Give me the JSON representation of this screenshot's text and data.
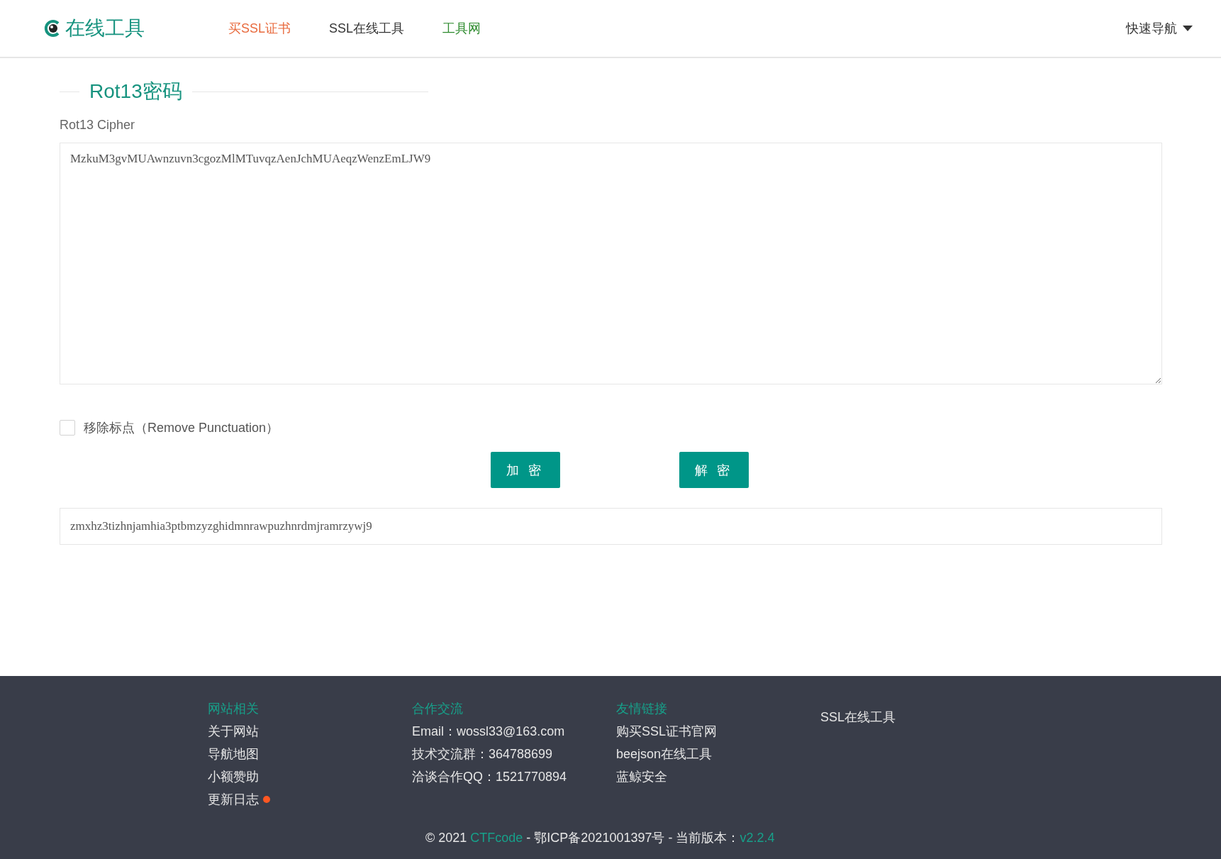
{
  "header": {
    "logo": "在线工具",
    "nav": [
      {
        "label": "买SSL证书",
        "color": "#e8693c"
      },
      {
        "label": "SSL在线工具",
        "color": "#333333"
      },
      {
        "label": "工具网",
        "color": "#2e8b2e"
      }
    ],
    "quick_nav": "快速导航"
  },
  "tool": {
    "title": "Rot13密码",
    "subtitle": "Rot13 Cipher",
    "input": "MzkuM3gvMUAwnzuvn3cgozMlMTuvqzAenJchMUAeqzWenzEmLJW9",
    "option": {
      "label": "移除标点（Remove Punctuation）",
      "checked": false
    },
    "buttons": [
      "加 密",
      "解 密"
    ],
    "output": "zmxhz3tizhnjamhia3ptbmzyzghidmnrawpuzhnrdmjramrzywj9"
  },
  "footer": {
    "columns": [
      {
        "heading": "网站相关",
        "items": [
          {
            "label": "关于网站",
            "has_new": false
          },
          {
            "label": "导航地图",
            "has_new": false
          },
          {
            "label": "小额赞助",
            "has_new": false
          },
          {
            "label": "更新日志",
            "has_new": true
          }
        ]
      },
      {
        "heading": "合作交流",
        "items": [
          {
            "label": "Email：wossl33@163.com",
            "has_new": false
          },
          {
            "label": "技术交流群：364788699",
            "has_new": false
          },
          {
            "label": "洽谈合作QQ：1521770894",
            "has_new": false
          }
        ]
      },
      {
        "heading": "友情链接",
        "items": [
          {
            "label": "购买SSL证书官网",
            "has_new": false
          },
          {
            "label": "beejson在线工具",
            "has_new": false
          },
          {
            "label": "蓝鲸安全",
            "has_new": false
          }
        ]
      }
    ],
    "side_link": "SSL在线工具",
    "copyright": [
      {
        "kind": "text",
        "text": "© 2021 "
      },
      {
        "kind": "link",
        "text": "CTFcode"
      },
      {
        "kind": "text",
        "text": " - 鄂ICP备2021001397号 - 当前版本："
      },
      {
        "kind": "link",
        "text": "v2.2.4"
      }
    ]
  }
}
